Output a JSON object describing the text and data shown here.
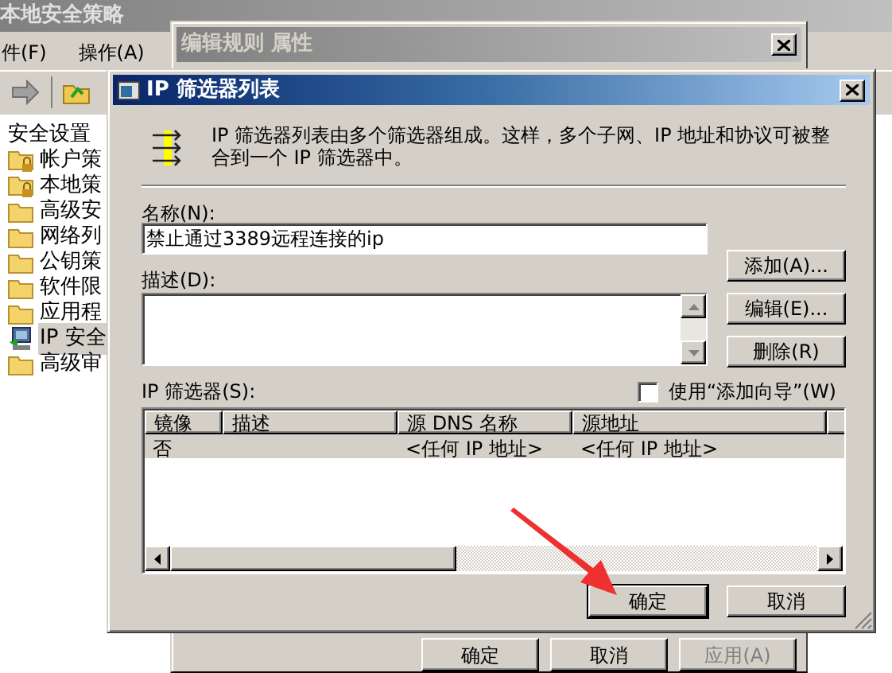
{
  "main_window": {
    "title": "本地安全策略",
    "menu": [
      "件(F)",
      "操作(A)"
    ],
    "tree": [
      {
        "label": "安全设置",
        "children": [
          {
            "label": "帐户策",
            "kind": "locked-folder",
            "selected": false
          },
          {
            "label": "本地策",
            "kind": "locked-folder",
            "selected": false
          },
          {
            "label": "高级安",
            "kind": "folder",
            "selected": false
          },
          {
            "label": "网络列",
            "kind": "folder",
            "selected": false
          },
          {
            "label": "公钥策",
            "kind": "folder",
            "selected": false
          },
          {
            "label": "软件限",
            "kind": "folder",
            "selected": false
          },
          {
            "label": "应用程",
            "kind": "folder",
            "selected": false
          },
          {
            "label": "IP 安全",
            "kind": "ip-policy",
            "selected": true
          },
          {
            "label": "高级审",
            "kind": "folder",
            "selected": false
          }
        ]
      }
    ]
  },
  "rule_dialog": {
    "title": "编辑规则 属性",
    "buttons": [
      {
        "label": "确定",
        "disabled": false
      },
      {
        "label": "取消",
        "disabled": false
      },
      {
        "label": "应用(A)",
        "disabled": true
      }
    ]
  },
  "filter_dialog": {
    "title": "IP 筛选器列表",
    "intro": "IP 筛选器列表由多个筛选器组成。这样，多个子网、IP 地址和协议可被整合到一个 IP 筛选器中。",
    "name_label": "名称(N):",
    "name_value": "禁止通过3389远程连接的ip",
    "description_label": "描述(D):",
    "side_buttons": [
      "添加(A)...",
      "编辑(E)...",
      "删除(R)"
    ],
    "filters_label": "IP 筛选器(S):",
    "wizard": {
      "label": "使用“添加向导”(W)",
      "checked": false
    },
    "table": {
      "columns": [
        "镜像",
        "描述",
        "源 DNS 名称",
        "源地址"
      ],
      "rows": [
        {
          "mirror": "否",
          "source_dns": "<任何 IP 地址>",
          "source_address": "<任何 IP 地址>",
          "selected": true
        }
      ]
    },
    "buttons": [
      {
        "label": "确定",
        "default": true
      },
      {
        "label": "取消",
        "default": false
      }
    ]
  }
}
